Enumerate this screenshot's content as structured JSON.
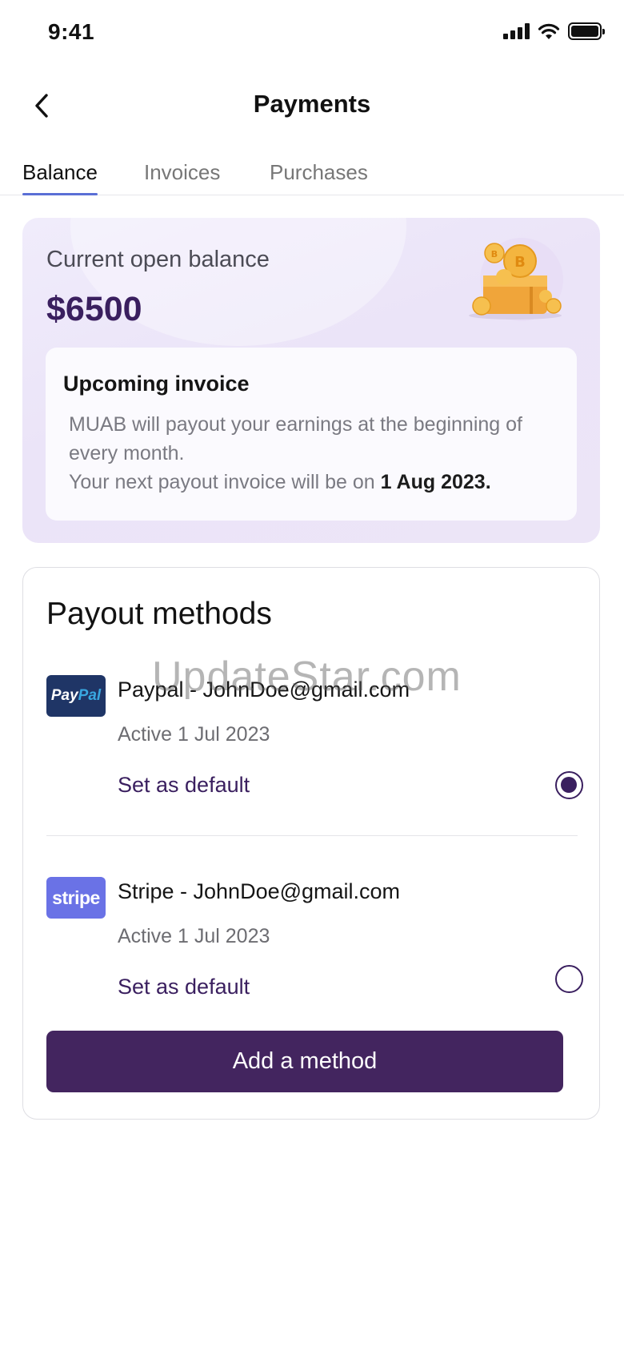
{
  "status_bar": {
    "time": "9:41"
  },
  "header": {
    "title": "Payments"
  },
  "tabs": [
    {
      "label": "Balance",
      "active": true
    },
    {
      "label": "Invoices",
      "active": false
    },
    {
      "label": "Purchases",
      "active": false
    }
  ],
  "balance": {
    "label": "Current open balance",
    "amount": "$6500",
    "illustration": "gold-coins-box-icon"
  },
  "upcoming_invoice": {
    "title": "Upcoming invoice",
    "line1": "MUAB will payout your earnings at the beginning of every month.",
    "line2_prefix": "Your next payout invoice will be on ",
    "line2_date": "1 Aug 2023."
  },
  "payout": {
    "title": "Payout methods",
    "methods": [
      {
        "logo": "PayPal",
        "name": "Paypal - JohnDoe@gmail.com",
        "status": "Active 1 Jul 2023",
        "action": "Set as default",
        "default": true
      },
      {
        "logo": "stripe",
        "name": "Stripe - JohnDoe@gmail.com",
        "status": "Active 1 Jul 2023",
        "action": "Set as default",
        "default": false
      }
    ],
    "add_button": "Add a method"
  },
  "watermark": "UpdateStar.com",
  "colors": {
    "accent": "#43255f",
    "tab_underline": "#5a6fd6",
    "paypal": "#1f3566",
    "stripe": "#6a72e6"
  }
}
